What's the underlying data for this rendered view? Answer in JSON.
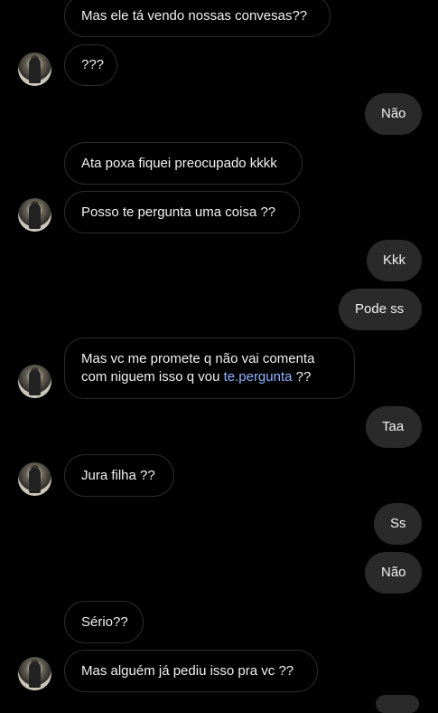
{
  "messages": [
    {
      "side": "in",
      "text": "Mas ele tá vendo nossas convesas??"
    },
    {
      "side": "in",
      "text": "???",
      "avatar": true
    },
    {
      "side": "out",
      "text": "Não"
    },
    {
      "side": "in",
      "text": "Ata poxa fiquei preocupado kkkk"
    },
    {
      "side": "in",
      "text": "Posso te pergunta uma coisa ??",
      "avatar": true
    },
    {
      "side": "out",
      "text": "Kkk"
    },
    {
      "side": "out",
      "text": "Pode ss"
    },
    {
      "side": "in",
      "line1": "Mas vc me promete q não vai comenta",
      "line2_prefix": "com niguem isso q vou ",
      "line2_link": "te.pergunta",
      "line2_suffix": " ??",
      "avatar": true
    },
    {
      "side": "out",
      "text": "Taa"
    },
    {
      "side": "in",
      "text": "Jura filha ??",
      "avatar": true
    },
    {
      "side": "out",
      "text": "Ss"
    },
    {
      "side": "out",
      "text": "Não"
    },
    {
      "side": "in",
      "text": "Sério??"
    },
    {
      "side": "in",
      "text": "Mas alguém já pediu isso pra vc ??",
      "avatar": true
    }
  ]
}
